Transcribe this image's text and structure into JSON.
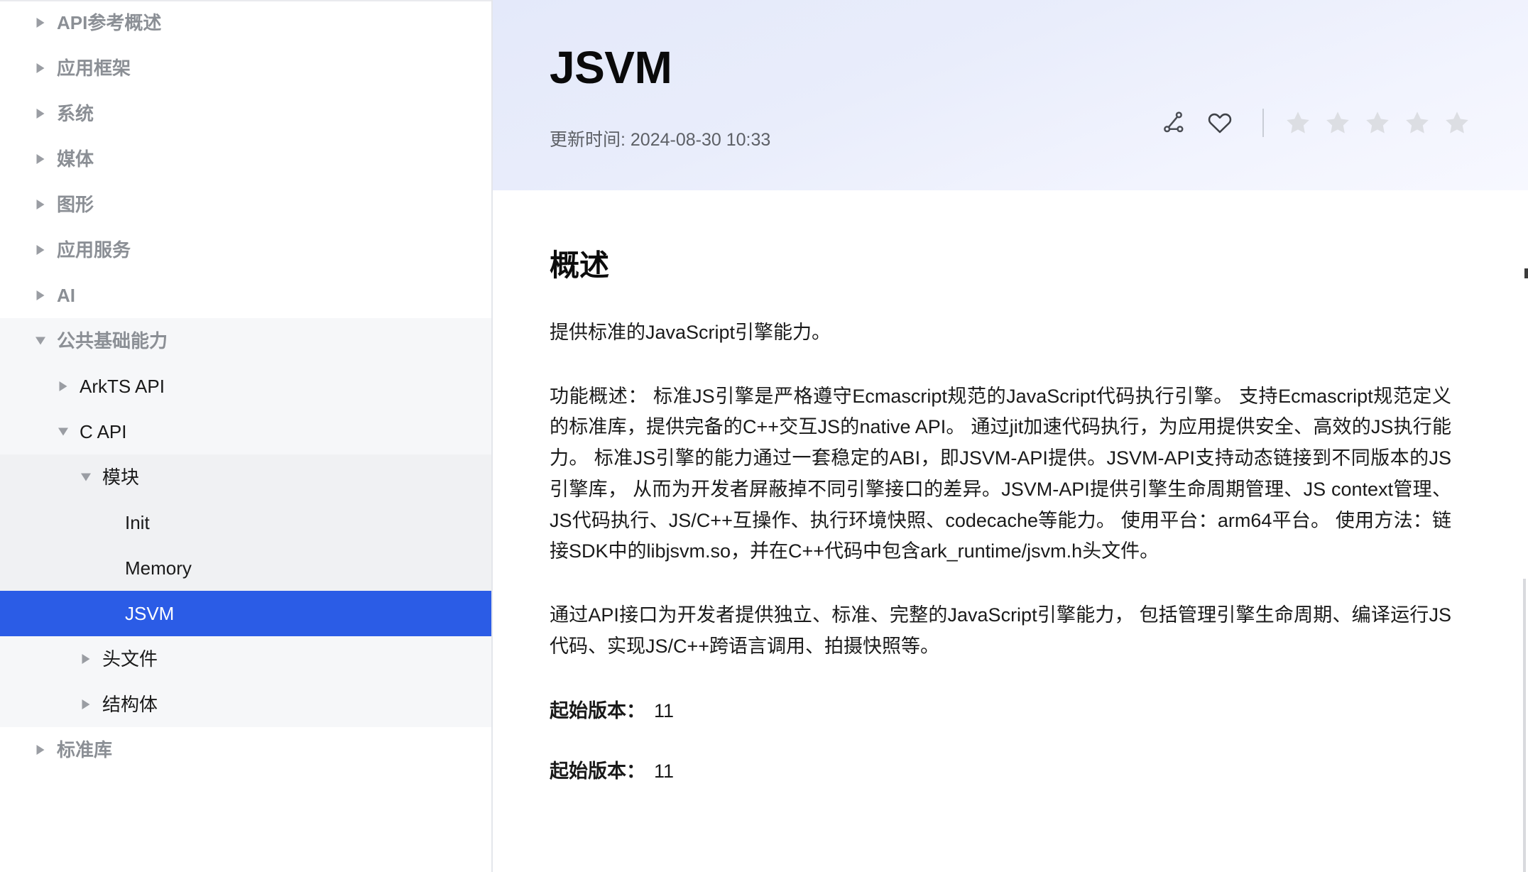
{
  "sidebar": {
    "items": [
      {
        "label": "API参考概述",
        "level": 1,
        "caret": "collapsed",
        "tier": "white",
        "selected": false
      },
      {
        "label": "应用框架",
        "level": 1,
        "caret": "collapsed",
        "tier": "white",
        "selected": false
      },
      {
        "label": "系统",
        "level": 1,
        "caret": "collapsed",
        "tier": "white",
        "selected": false
      },
      {
        "label": "媒体",
        "level": 1,
        "caret": "collapsed",
        "tier": "white",
        "selected": false
      },
      {
        "label": "图形",
        "level": 1,
        "caret": "collapsed",
        "tier": "white",
        "selected": false
      },
      {
        "label": "应用服务",
        "level": 1,
        "caret": "collapsed",
        "tier": "white",
        "selected": false
      },
      {
        "label": "AI",
        "level": 1,
        "caret": "collapsed",
        "tier": "white",
        "selected": false
      },
      {
        "label": "公共基础能力",
        "level": 1,
        "caret": "expanded",
        "tier": "l2",
        "selected": false
      },
      {
        "label": "ArkTS API",
        "level": 2,
        "caret": "collapsed",
        "tier": "l2",
        "selected": false
      },
      {
        "label": "C API",
        "level": 2,
        "caret": "expanded",
        "tier": "l2",
        "selected": false
      },
      {
        "label": "模块",
        "level": 3,
        "caret": "expanded",
        "tier": "l3",
        "selected": false
      },
      {
        "label": "Init",
        "level": 4,
        "caret": "none",
        "tier": "l3",
        "selected": false
      },
      {
        "label": "Memory",
        "level": 4,
        "caret": "none",
        "tier": "l3",
        "selected": false
      },
      {
        "label": "JSVM",
        "level": 4,
        "caret": "none",
        "tier": "l3",
        "selected": true
      },
      {
        "label": "头文件",
        "level": 3,
        "caret": "collapsed",
        "tier": "l2",
        "selected": false
      },
      {
        "label": "结构体",
        "level": 3,
        "caret": "collapsed",
        "tier": "l2",
        "selected": false
      },
      {
        "label": "标准库",
        "level": 1,
        "caret": "collapsed",
        "tier": "white",
        "selected": false
      }
    ]
  },
  "header": {
    "title": "JSVM",
    "updated_label": "更新时间: 2024-08-30 10:33",
    "actions": [
      {
        "name": "share-icon",
        "label": "分享"
      },
      {
        "name": "heart-icon",
        "label": "收藏"
      }
    ],
    "rating": {
      "stars_total": 5,
      "stars_filled": 0,
      "star_color": "#dcdee3"
    }
  },
  "content": {
    "section_title": "概述",
    "lead": "提供标准的JavaScript引擎能力。",
    "paragraph_1": "功能概述： 标准JS引擎是严格遵守Ecmascript规范的JavaScript代码执行引擎。 支持Ecmascript规范定义的标准库，提供完备的C++交互JS的native API。 通过jit加速代码执行，为应用提供安全、高效的JS执行能力。 标准JS引擎的能力通过一套稳定的ABI，即JSVM-API提供。JSVM-API支持动态链接到不同版本的JS引擎库， 从而为开发者屏蔽掉不同引擎接口的差异。JSVM-API提供引擎生命周期管理、JS context管理、 JS代码执行、JS/C++互操作、执行环境快照、codecache等能力。 使用平台：arm64平台。 使用方法：链接SDK中的libjsvm.so，并在C++代码中包含ark_runtime/jsvm.h头文件。",
    "paragraph_2": "通过API接口为开发者提供独立、标准、完整的JavaScript引擎能力， 包括管理引擎生命周期、编译运行JS代码、实现JS/C++跨语言调用、拍摄快照等。",
    "versions": [
      {
        "label": "起始版本：",
        "value": "11"
      },
      {
        "label": "起始版本：",
        "value": "11"
      }
    ]
  },
  "theme": {
    "accent": "#2b5ce6",
    "sidebar_border": "#e4e6eb",
    "muted_text": "#8b8f95",
    "body_text": "#1a1a1a"
  }
}
